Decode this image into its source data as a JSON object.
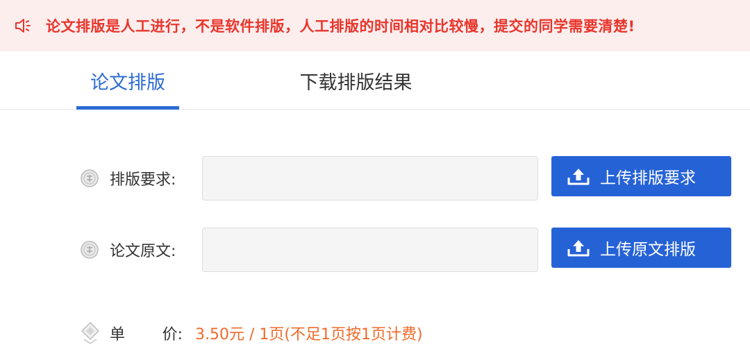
{
  "notice": {
    "icon": "speaker-icon",
    "text": "论文排版是人工进行，不是软件排版，人工排版的时间相对比较慢，提交的同学需要清楚!",
    "color": "#e8352b",
    "background": "#fdeeee"
  },
  "tabs": [
    {
      "label": "论文排版",
      "active": true
    },
    {
      "label": "下载排版结果",
      "active": false
    }
  ],
  "accent": "#2d6bd2",
  "form": {
    "requirements": {
      "label": "排版要求:",
      "icon": "seal-icon",
      "value": "",
      "button": "上传排版要求",
      "button_icon": "upload-icon"
    },
    "original": {
      "label": "论文原文:",
      "icon": "seal-icon",
      "value": "",
      "button": "上传原文排版",
      "button_icon": "upload-icon"
    }
  },
  "price": {
    "label_left": "单",
    "label_right": "价:",
    "icon": "diamond-tag-icon",
    "value": "3.50元 / 1页(不足1页按1页计费)",
    "color": "#ef6a2b"
  }
}
